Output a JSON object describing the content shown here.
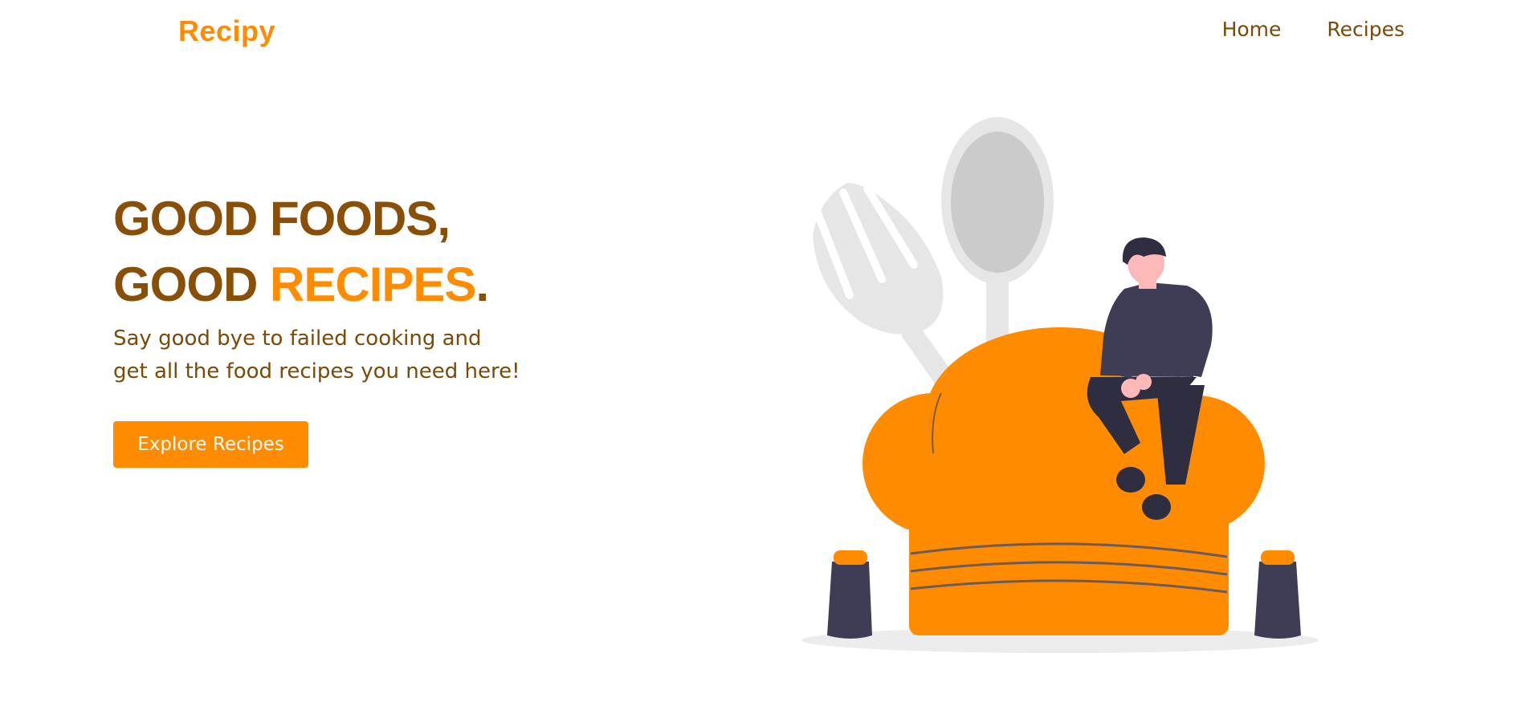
{
  "navbar": {
    "logo": "Recipy",
    "links": [
      {
        "label": "Home"
      },
      {
        "label": "Recipes"
      }
    ]
  },
  "hero": {
    "headline_line1": "GOOD FOODS,",
    "headline_line2_prefix": "GOOD ",
    "headline_line2_accent": "RECIPES",
    "headline_line2_suffix": ".",
    "subtitle_line1": "Say good bye to failed cooking and",
    "subtitle_line2": "get all the food recipes you need here!",
    "cta_label": "Explore Recipes"
  },
  "colors": {
    "accent": "#ff8c00",
    "brown": "#8a4f06",
    "dark_figure": "#3f3d56",
    "utensil_gray": "#e6e6e6"
  },
  "icons": {
    "illustration": "chef-hat-with-person-illustration"
  }
}
